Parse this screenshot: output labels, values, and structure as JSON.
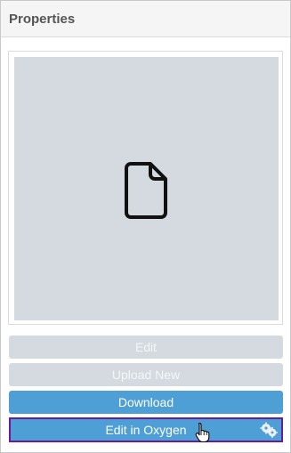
{
  "panel": {
    "title": "Properties"
  },
  "preview": {
    "icon": "file-icon"
  },
  "buttons": {
    "edit": "Edit",
    "upload_new": "Upload New",
    "download": "Download",
    "edit_in_oxygen": "Edit in Oxygen"
  },
  "icons": {
    "settings": "gears-icon",
    "pointer": "hand-cursor-icon"
  },
  "colors": {
    "accent": "#4e9fd6",
    "disabled": "#d5dae1",
    "focus_border": "#6a1b9a"
  }
}
